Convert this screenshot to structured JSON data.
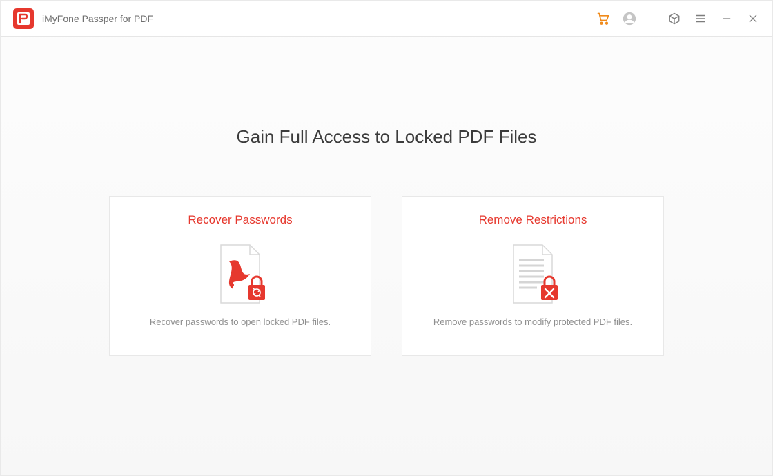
{
  "app": {
    "title": "iMyFone Passper for PDF"
  },
  "headline": "Gain Full Access to Locked PDF Files",
  "cards": {
    "recover": {
      "title": "Recover Passwords",
      "desc": "Recover passwords to open locked PDF files."
    },
    "remove": {
      "title": "Remove Restrictions",
      "desc": "Remove passwords to modify protected PDF files."
    }
  },
  "colors": {
    "accent": "#e6382e",
    "cart": "#f08a1a",
    "text_muted": "#8f8f8f"
  }
}
